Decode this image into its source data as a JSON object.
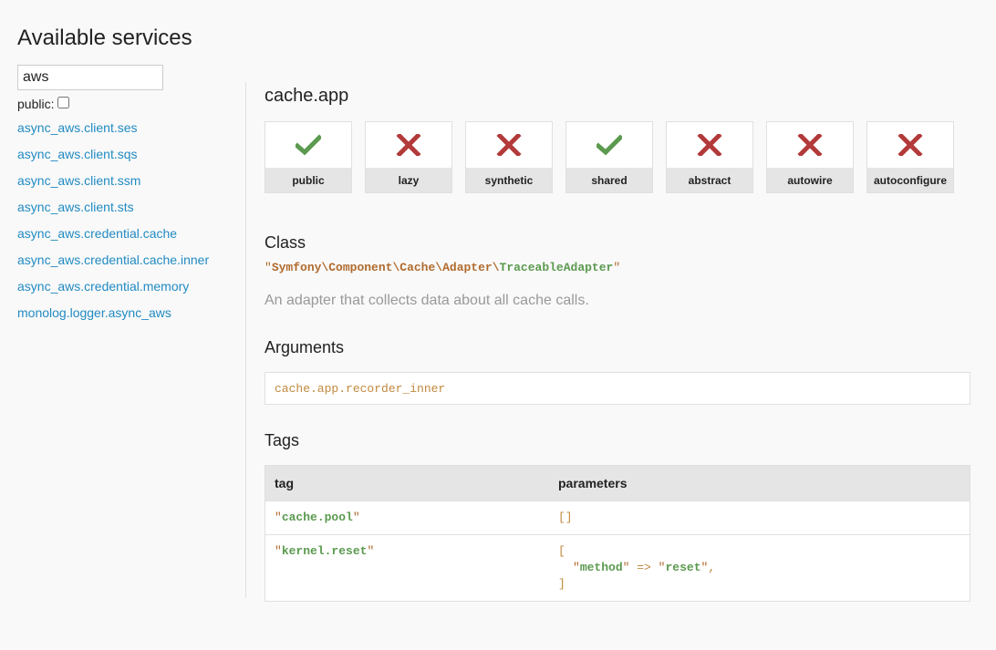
{
  "page": {
    "title": "Available services"
  },
  "sidebar": {
    "search_value": "aws",
    "public_label": "public:",
    "items": [
      "async_aws.client.ses",
      "async_aws.client.sqs",
      "async_aws.client.ssm",
      "async_aws.client.sts",
      "async_aws.credential.cache",
      "async_aws.credential.cache.inner",
      "async_aws.credential.memory",
      "monolog.logger.async_aws"
    ]
  },
  "service": {
    "title": "cache.app",
    "flags": [
      {
        "label": "public",
        "enabled": true
      },
      {
        "label": "lazy",
        "enabled": false
      },
      {
        "label": "synthetic",
        "enabled": false
      },
      {
        "label": "shared",
        "enabled": true
      },
      {
        "label": "abstract",
        "enabled": false
      },
      {
        "label": "autowire",
        "enabled": false
      },
      {
        "label": "autoconfigure",
        "enabled": false
      }
    ],
    "class_section_title": "Class",
    "class_namespace_parts": [
      "Symfony",
      "Component",
      "Cache",
      "Adapter"
    ],
    "class_short_name": "TraceableAdapter",
    "class_description": "An adapter that collects data about all cache calls.",
    "arguments_section_title": "Arguments",
    "argument": "cache.app.recorder_inner",
    "tags_section_title": "Tags",
    "tags_table": {
      "headers": [
        "tag",
        "parameters"
      ],
      "rows": [
        {
          "tag": "cache.pool",
          "params_empty": "[]"
        },
        {
          "tag": "kernel.reset",
          "param_key": "method",
          "param_arrow": "=>",
          "param_value": "reset"
        }
      ]
    }
  },
  "colors": {
    "check": "#5b9a4f",
    "cross": "#b23a3a",
    "link": "#218bc3"
  },
  "icons": {
    "enabled": "checkmark-icon",
    "disabled": "cross-icon"
  }
}
